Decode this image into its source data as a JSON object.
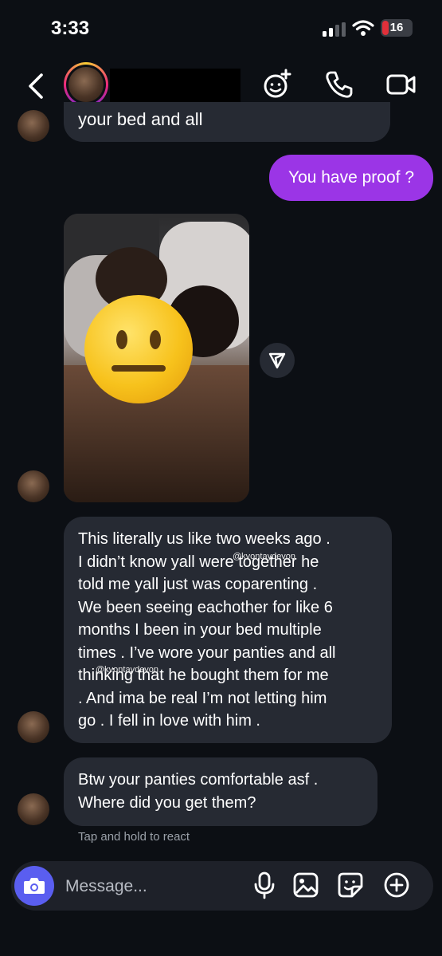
{
  "status_bar": {
    "time": "3:33",
    "battery": "16"
  },
  "header": {
    "back_icon": "chevron-left-icon",
    "effects_icon": "face-sparkle-icon",
    "call_icon": "phone-icon",
    "video_icon": "video-camera-icon"
  },
  "messages": [
    {
      "direction": "incoming",
      "text": "your bed and all"
    },
    {
      "direction": "outgoing",
      "text": "You have proof ?"
    },
    {
      "direction": "incoming",
      "type": "photo"
    },
    {
      "direction": "incoming",
      "lines": [
        "This literally us like two weeks ago .",
        "I didn’t know yall were together he",
        "told me yall just was coparenting .",
        "We been seeing eachother for like 6",
        "months I been in your bed multiple",
        "times . I’ve wore your panties and all",
        "thinking that he bought them for me",
        ". And ima be real I’m not letting him",
        "go . I fell in love with him ."
      ]
    },
    {
      "direction": "incoming",
      "lines": [
        "Btw your panties comfortable asf .",
        "Where did you get them?"
      ]
    }
  ],
  "watermark": "@kvontaydevon",
  "react_hint": "Tap and hold to react",
  "composer": {
    "placeholder": "Message..."
  },
  "colors": {
    "background": "#0c0f14",
    "incoming_bubble": "#262a33",
    "outgoing_bubble": "#9b35e6",
    "camera_button": "#5a5ef0"
  }
}
